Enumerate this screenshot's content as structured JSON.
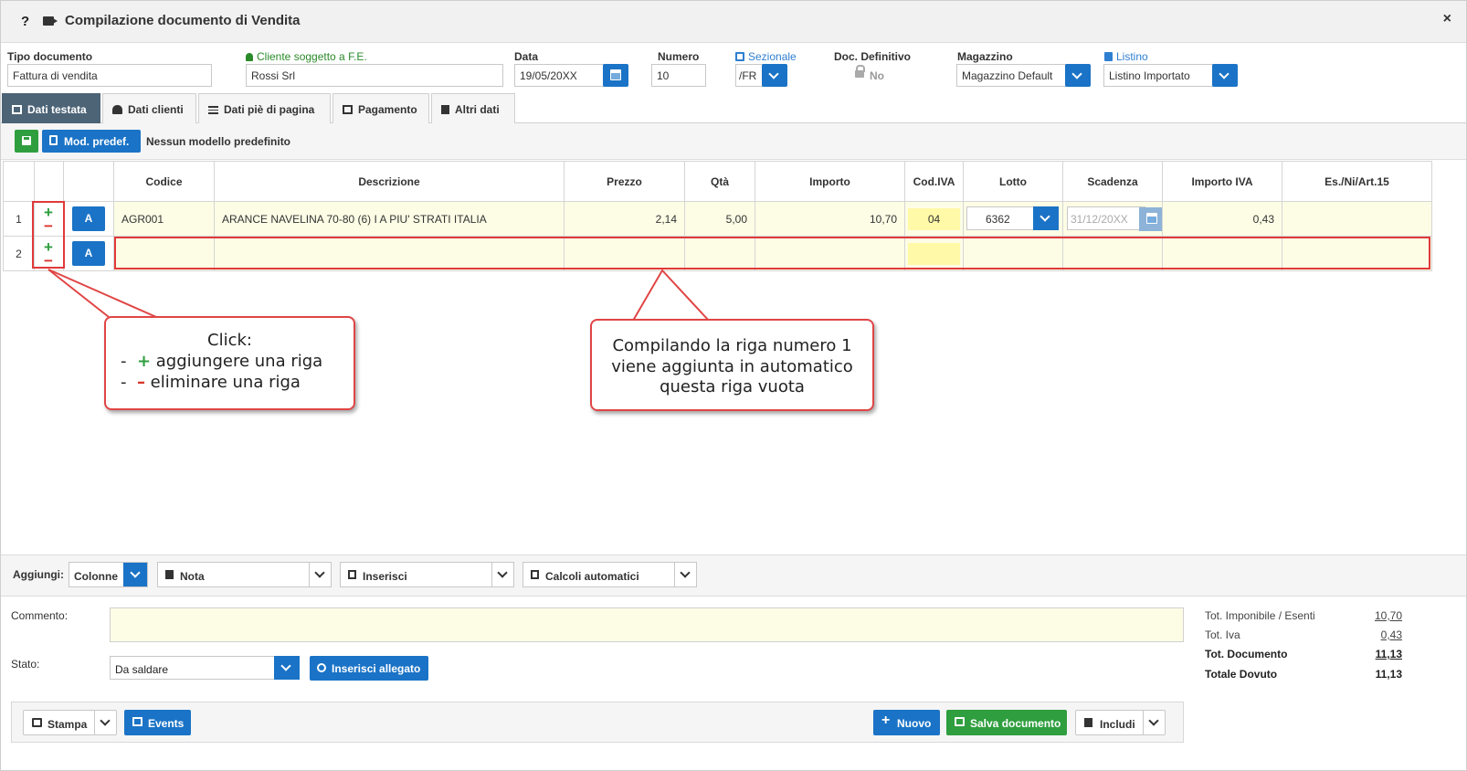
{
  "window": {
    "title": "Compilazione documento di Vendita",
    "help": "?",
    "close": "×"
  },
  "header": {
    "tipo_label": "Tipo documento",
    "tipo_value": "Fattura di vendita",
    "cliente_label": "Cliente soggetto a F.E.",
    "cliente_value": "Rossi Srl",
    "data_label": "Data",
    "data_value": "19/05/20XX",
    "numero_label": "Numero",
    "numero_value": "10",
    "sezionale_label": "Sezionale",
    "sezionale_value": "/FR",
    "definitivo_label": "Doc. Definitivo",
    "definitivo_value": "No",
    "magazzino_label": "Magazzino",
    "magazzino_value": "Magazzino Default",
    "listino_label": "Listino",
    "listino_value": "Listino Importato"
  },
  "tabs": [
    "Dati testata",
    "Dati clienti",
    "Dati piè di pagina",
    "Pagamento",
    "Altri dati"
  ],
  "toolbar": {
    "mod_label": "Mod. predef.",
    "mod_text": "Nessun modello predefinito"
  },
  "table": {
    "headers": [
      "Codice",
      "Descrizione",
      "Prezzo",
      "Qtà",
      "Importo",
      "Cod.IVA",
      "Lotto",
      "Scadenza",
      "Importo IVA",
      "Es./Ni/Art.15"
    ],
    "rows": [
      {
        "idx": "1",
        "a": "A",
        "codice": "AGR001",
        "descrizione": "ARANCE NAVELINA 70-80 (6) I A PIU' STRATI     ITALIA",
        "prezzo": "2,14",
        "qta": "5,00",
        "importo": "10,70",
        "iva": "04",
        "lotto": "6362",
        "scadenza": "31/12/20XX",
        "importo_iva": "0,43"
      },
      {
        "idx": "2",
        "a": "A"
      }
    ],
    "plus": "+",
    "minus": "−"
  },
  "callouts": {
    "left_line1": "Click:",
    "left_line2_prefix": "-  ",
    "left_line2_sym": "+",
    "left_line2_text": " aggiungere una riga",
    "left_line3_prefix": "-  ",
    "left_line3_sym": "–",
    "left_line3_text": " eliminare una riga",
    "right_line1": "Compilando la riga numero 1",
    "right_line2": "viene aggiunta in automatico",
    "right_line3": "questa riga vuota"
  },
  "aggiungi": {
    "label": "Aggiungi:",
    "colonne": "Colonne",
    "nota": "Nota",
    "inserisci": "Inserisci",
    "calcoli": "Calcoli automatici"
  },
  "commento_label": "Commento:",
  "stato": {
    "label": "Stato:",
    "value": "Da saldare",
    "allegato": "Inserisci allegato"
  },
  "totals": [
    {
      "label": "Tot. Imponibile / Esenti",
      "value": "10,70"
    },
    {
      "label": "Tot. Iva",
      "value": "0,43"
    },
    {
      "label": "Tot. Documento",
      "value": "11,13"
    },
    {
      "label": "Totale Dovuto",
      "value": "11,13"
    }
  ],
  "footer": {
    "stampa": "Stampa",
    "events": "Events",
    "nuovo": "Nuovo",
    "salva": "Salva documento",
    "includi": "Includi"
  },
  "colors": {
    "primary": "#1a73c6",
    "success": "#2f9e3f",
    "danger": "#e03a3a",
    "tab_active": "#4d6477",
    "row_bg": "#fdfde6",
    "iva_bg": "#fff9a8"
  }
}
